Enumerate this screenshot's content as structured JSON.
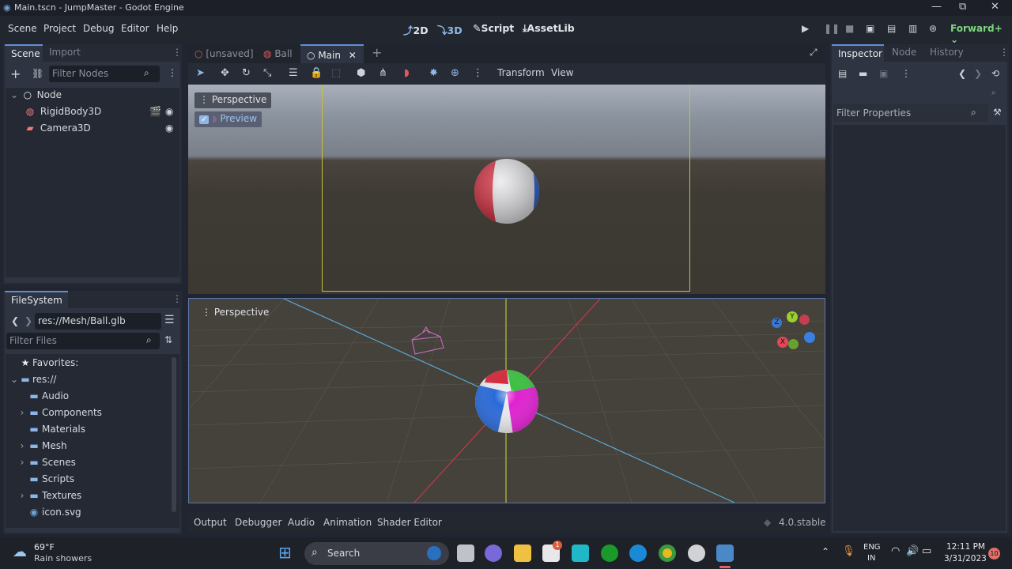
{
  "window": {
    "title": "Main.tscn - JumpMaster - Godot Engine",
    "min": "—",
    "max": "⧉",
    "close": "✕"
  },
  "menu": [
    "Scene",
    "Project",
    "Debug",
    "Editor",
    "Help"
  ],
  "modes": {
    "d2": "2D",
    "d3": "3D",
    "script": "Script",
    "assetlib": "AssetLib"
  },
  "renderer": "Forward+",
  "scene_dock": {
    "tabs": [
      "Scene",
      "Import"
    ],
    "filter_placeholder": "Filter Nodes",
    "nodes": [
      {
        "label": "Node"
      },
      {
        "label": "RigidBody3D"
      },
      {
        "label": "Camera3D"
      }
    ]
  },
  "filesystem": {
    "tab": "FileSystem",
    "path": "res://Mesh/Ball.glb",
    "filter_placeholder": "Filter Files",
    "favorites": "Favorites:",
    "root": "res://",
    "folders": [
      "Audio",
      "Components",
      "Materials",
      "Mesh",
      "Scenes",
      "Scripts",
      "Textures"
    ],
    "file": "icon.svg"
  },
  "scene_tabs": [
    "[unsaved]",
    "Ball",
    "Main"
  ],
  "toolbar": {
    "transform": "Transform",
    "view": "View"
  },
  "viewport1": {
    "label": "Perspective",
    "preview": "Preview"
  },
  "viewport2": {
    "label": "Perspective"
  },
  "gizmo": {
    "x": "X",
    "y": "Y",
    "z": "Z"
  },
  "bottom_tabs": [
    "Output",
    "Debugger",
    "Audio",
    "Animation",
    "Shader Editor"
  ],
  "version": "4.0.stable",
  "inspector": {
    "tabs": [
      "Inspector",
      "Node",
      "History"
    ],
    "filter_placeholder": "Filter Properties"
  },
  "taskbar": {
    "weather_temp": "69°F",
    "weather_desc": "Rain showers",
    "search": "Search",
    "lang1": "ENG",
    "lang2": "IN",
    "time": "12:11 PM",
    "date": "3/31/2023",
    "notif": "10",
    "badge": "1"
  }
}
